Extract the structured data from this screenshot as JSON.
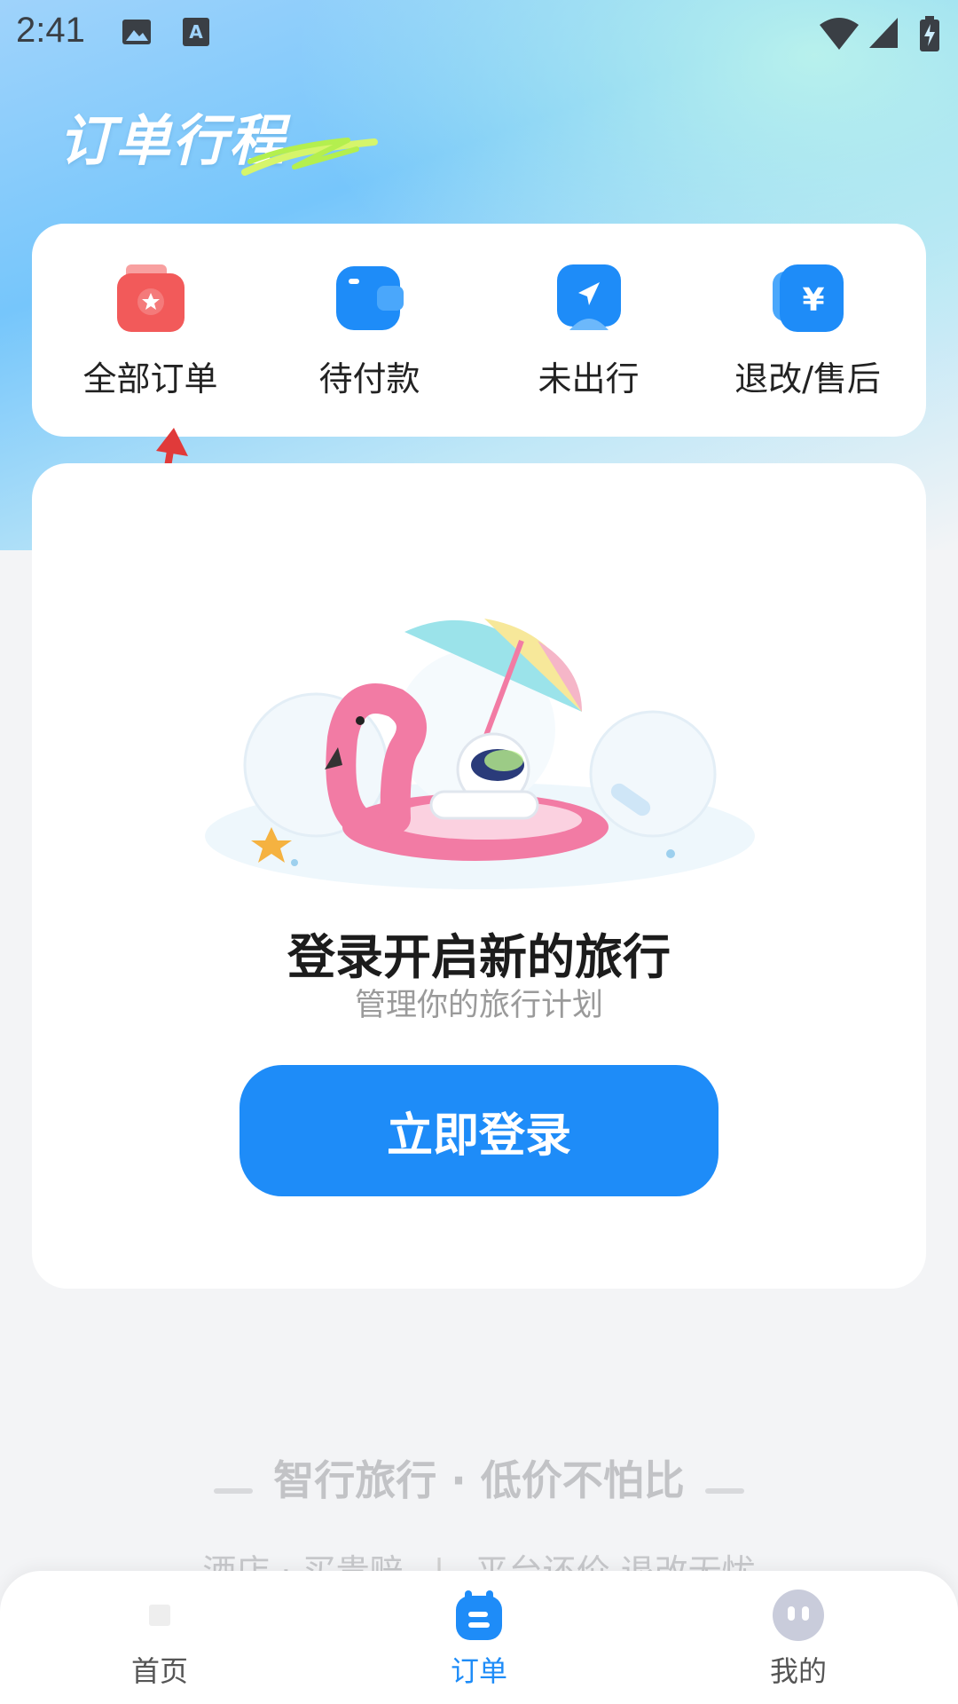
{
  "status_bar": {
    "time": "2:41"
  },
  "header": {
    "title": "订单行程"
  },
  "quick_menu": [
    {
      "label": "全部订单",
      "icon": "folder-star-icon",
      "color": "#f25a5a"
    },
    {
      "label": "待付款",
      "icon": "wallet-icon",
      "color": "#1e8cf8"
    },
    {
      "label": "未出行",
      "icon": "navigation-icon",
      "color": "#1e8cf8"
    },
    {
      "label": "退改/售后",
      "icon": "yuan-refund-icon",
      "color": "#1e8cf8"
    }
  ],
  "empty_state": {
    "title": "登录开启新的旅行",
    "subtitle": "管理你的旅行计划",
    "button_label": "立即登录"
  },
  "slogan": {
    "text": "智行旅行 · 低价不怕比",
    "left_item": "酒店 · 买贵赔",
    "right_item": "平台还价 退改无忧"
  },
  "bottom_nav": [
    {
      "label": "首页",
      "icon": "home-icon",
      "active": false
    },
    {
      "label": "订单",
      "icon": "order-icon",
      "active": true
    },
    {
      "label": "我的",
      "icon": "profile-icon",
      "active": false
    }
  ],
  "colors": {
    "accent": "#1e8cf8",
    "annotation": "#e03a3a"
  }
}
